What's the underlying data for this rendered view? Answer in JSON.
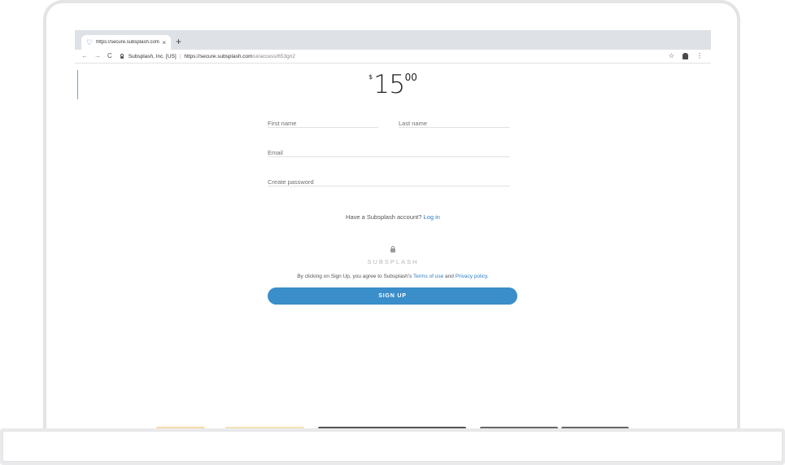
{
  "browser": {
    "tab": {
      "title": "https://secure.subsplash.com/",
      "close_glyph": "×"
    },
    "new_tab_glyph": "+",
    "toolbar": {
      "back_glyph": "←",
      "forward_glyph": "→",
      "reload_glyph": "C",
      "site_identity": "Subsplash, Inc. [US]",
      "url_host": "https://secure.subsplash.com",
      "url_path": "/ui/access/653gn2",
      "star_glyph": "☆",
      "menu_glyph": "⋮"
    }
  },
  "page": {
    "price": {
      "currency": "$",
      "dollars": "15",
      "cents": "00"
    },
    "fields": {
      "first_name_placeholder": "First name",
      "last_name_placeholder": "Last name",
      "email_placeholder": "Email",
      "password_placeholder": "Create password"
    },
    "account_prompt": "Have a Subsplash account?",
    "login_link": "Log in",
    "brand_name": "SUBSPLASH",
    "terms": {
      "prefix": "By clicking on Sign Up, you agree to Subsplash's",
      "terms_link": "Terms of use",
      "conjunction": "and",
      "privacy_link": "Privacy policy."
    },
    "signup_label": "SIGN UP"
  },
  "colors": {
    "accent": "#3a8ec9",
    "link": "#2f7fc5",
    "tabbar": "#dee1e6",
    "bezel": "#e4e4e6"
  }
}
